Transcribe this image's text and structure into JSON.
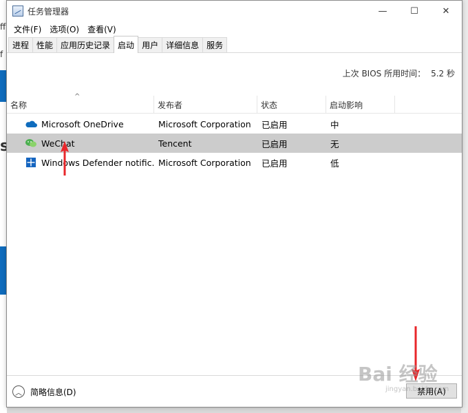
{
  "background": {
    "fragments": [
      "ff",
      "f",
      "s"
    ]
  },
  "window": {
    "title": "任务管理器",
    "controls": {
      "minimize": "—",
      "maximize": "☐",
      "close": "✕"
    }
  },
  "menu": [
    {
      "label": "文件(F)"
    },
    {
      "label": "选项(O)"
    },
    {
      "label": "查看(V)"
    }
  ],
  "tabs": [
    {
      "label": "进程"
    },
    {
      "label": "性能"
    },
    {
      "label": "应用历史记录"
    },
    {
      "label": "启动",
      "active": true
    },
    {
      "label": "用户"
    },
    {
      "label": "详细信息"
    },
    {
      "label": "服务"
    }
  ],
  "bios": {
    "label": "上次 BIOS 所用时间：",
    "value": "5.2 秒"
  },
  "table": {
    "sort_indicator": "^",
    "columns": [
      "名称",
      "发布者",
      "状态",
      "启动影响"
    ],
    "rows": [
      {
        "name": "Microsoft OneDrive",
        "publisher": "Microsoft Corporation",
        "status": "已启用",
        "impact": "中",
        "icon": "onedrive-cloud-icon",
        "selected": false
      },
      {
        "name": "WeChat",
        "publisher": "Tencent",
        "status": "已启用",
        "impact": "无",
        "icon": "wechat-icon",
        "selected": true
      },
      {
        "name": "Windows Defender notific...",
        "publisher": "Microsoft Corporation",
        "status": "已启用",
        "impact": "低",
        "icon": "defender-shield-icon",
        "selected": false
      }
    ]
  },
  "footer": {
    "fewer_details": "简略信息(D)",
    "disable_button": "禁用(A)"
  },
  "watermark": {
    "text": "Bai 经验",
    "sub": "jingyan.baidu.com"
  },
  "colors": {
    "annotation_arrow": "#e8262a",
    "selected_row": "#cccccc",
    "onedrive": "#0f6cbd",
    "wechat": "#4caf50",
    "defender": "#1565c0"
  }
}
